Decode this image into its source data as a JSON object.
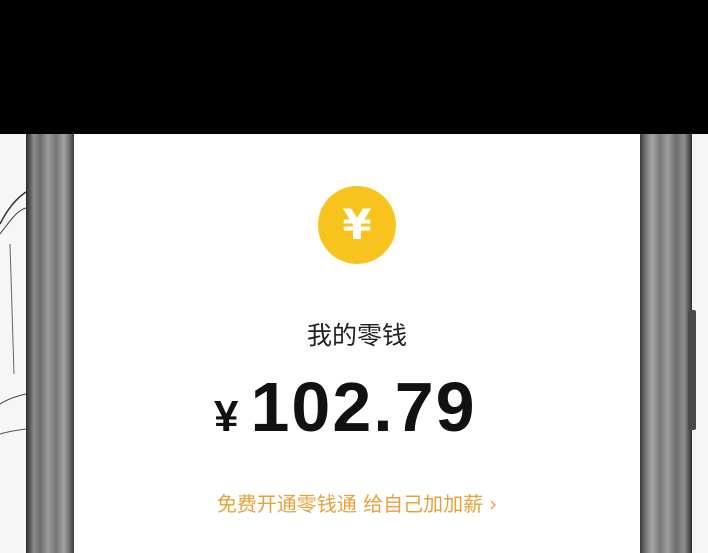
{
  "wallet": {
    "coin_symbol": "¥",
    "title": "我的零钱",
    "currency_symbol": "¥",
    "amount": "102.79",
    "promo_text": "免费开通零钱通 给自己加加薪",
    "promo_arrow": "›"
  },
  "colors": {
    "coin": "#f7c31c",
    "promo": "#e8a23a",
    "text": "#111111"
  },
  "icons": {
    "coin": "yuan-coin-icon",
    "arrow": "chevron-right-icon"
  }
}
